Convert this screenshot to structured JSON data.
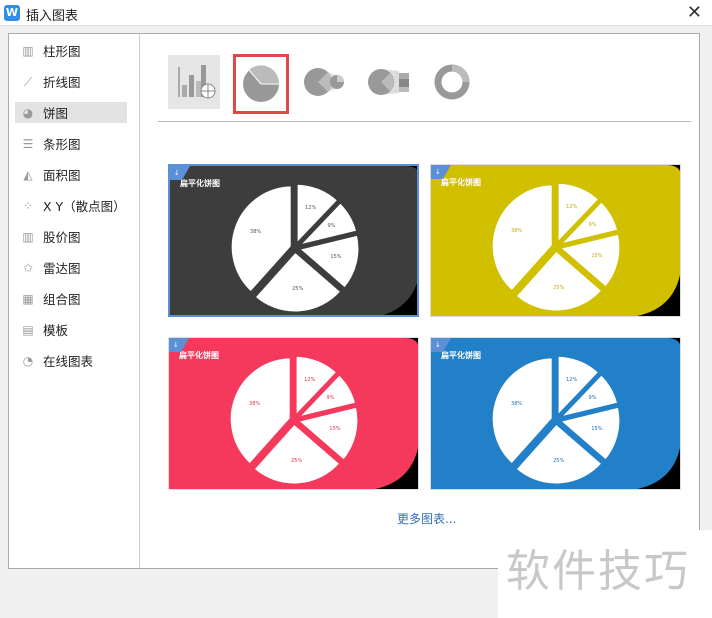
{
  "window": {
    "title": "插入图表",
    "close_icon": "close-icon"
  },
  "sidebar": {
    "selected": 2,
    "items": [
      {
        "label": "柱形图",
        "icon": "column-chart-icon"
      },
      {
        "label": "折线图",
        "icon": "line-chart-icon"
      },
      {
        "label": "饼图",
        "icon": "pie-chart-icon"
      },
      {
        "label": "条形图",
        "icon": "bar-chart-icon"
      },
      {
        "label": "面积图",
        "icon": "area-chart-icon"
      },
      {
        "label": "X Y（散点图）",
        "icon": "scatter-chart-icon"
      },
      {
        "label": "股价图",
        "icon": "stock-chart-icon"
      },
      {
        "label": "雷达图",
        "icon": "radar-chart-icon"
      },
      {
        "label": "组合图",
        "icon": "combo-chart-icon"
      },
      {
        "label": "模板",
        "icon": "template-icon"
      },
      {
        "label": "在线图表",
        "icon": "online-chart-icon"
      }
    ]
  },
  "subtypes": [
    "online-chart",
    "pie",
    "pie-of-pie",
    "bar-of-pie",
    "doughnut"
  ],
  "subtype_selected": 1,
  "cards": [
    {
      "title": "扁平化饼图",
      "bg": "#3d3d3d",
      "gap": "#3d3d3d",
      "label_color": "#555"
    },
    {
      "title": "扁平化饼图",
      "bg": "#d0c000",
      "gap": "#d0c000",
      "label_color": "#c8a800"
    },
    {
      "title": "扁平化饼图",
      "bg": "#f5395c",
      "gap": "#f5395c",
      "label_color": "#e03050"
    },
    {
      "title": "扁平化饼图",
      "bg": "#2280c8",
      "gap": "#2280c8",
      "label_color": "#2070b0"
    }
  ],
  "pie_values": [
    12,
    9,
    15,
    25,
    38
  ],
  "pie_labels": [
    "12%",
    "9%",
    "15%",
    "25%",
    "38%"
  ],
  "more_link": "更多图表...",
  "watermark": "软件技巧"
}
